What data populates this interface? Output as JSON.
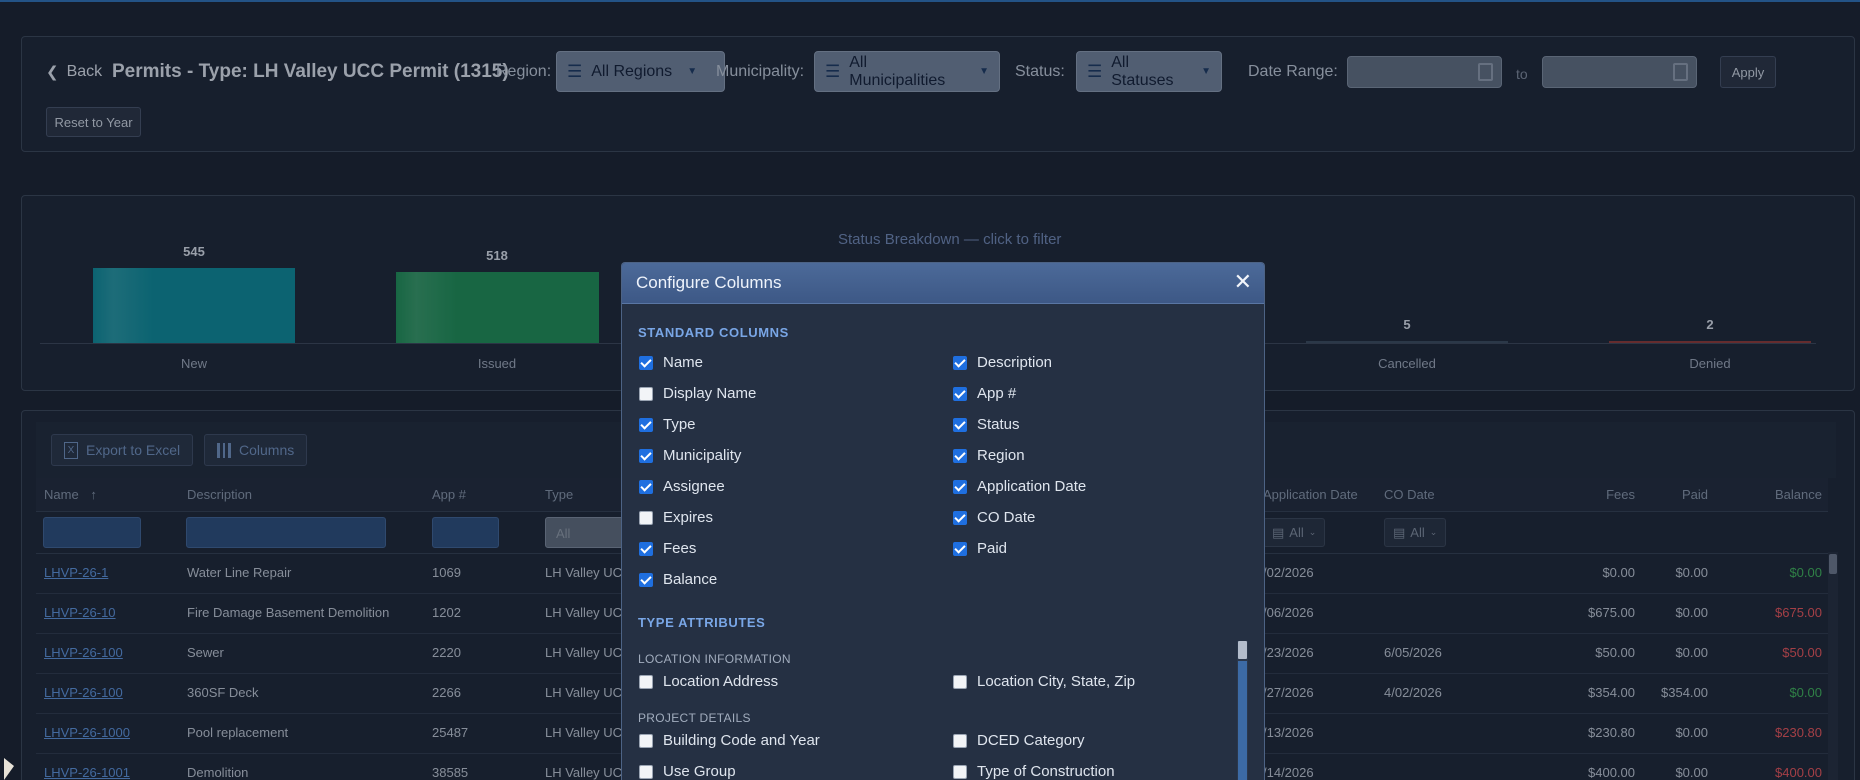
{
  "header": {
    "back_label": "Back",
    "title": "Permits - Type: LH Valley UCC Permit (1315)",
    "region_label": "Region:",
    "region_value": "All Regions",
    "municipality_label": "Municipality:",
    "municipality_value": "All Municipalities",
    "status_label": "Status:",
    "status_value": "All Statuses",
    "date_range_label": "Date Range:",
    "to_label": "to",
    "apply_label": "Apply",
    "reset_label": "Reset to Year"
  },
  "chart_data": {
    "type": "bar",
    "title": "Status Breakdown — click to filter",
    "categories": [
      "New",
      "Issued",
      "Cancelled",
      "Denied"
    ],
    "values": [
      545,
      518,
      5,
      2
    ],
    "colors": [
      "#0e8696",
      "#1f8a57",
      "#3a4a5e",
      "#8a3a3a"
    ]
  },
  "toolbar": {
    "export_label": "Export to Excel",
    "columns_label": "Columns"
  },
  "table": {
    "headers": [
      "Name",
      "Description",
      "App #",
      "Type",
      "Application Date",
      "CO Date",
      "Fees",
      "Paid",
      "Balance"
    ],
    "type_filter_placeholder": "All",
    "date_filter_all": "All",
    "rows": [
      {
        "name": "LHVP-26-1",
        "description": "Water Line Repair",
        "app": "1069",
        "type": "LH Valley UCC",
        "app_date": "/02/2026",
        "co_date": "",
        "fees": "$0.00",
        "paid": "$0.00",
        "balance": "$0.00",
        "bal_status": "zero"
      },
      {
        "name": "LHVP-26-10",
        "description": "Fire Damage Basement Demolition",
        "app": "1202",
        "type": "LH Valley UCC",
        "app_date": "/06/2026",
        "co_date": "",
        "fees": "$675.00",
        "paid": "$0.00",
        "balance": "$675.00",
        "bal_status": "due"
      },
      {
        "name": "LHVP-26-100",
        "description": "Sewer",
        "app": "2220",
        "type": "LH Valley UCC",
        "app_date": "/23/2026",
        "co_date": "6/05/2026",
        "fees": "$50.00",
        "paid": "$0.00",
        "balance": "$50.00",
        "bal_status": "due"
      },
      {
        "name": "LHVP-26-100",
        "description": "360SF Deck",
        "app": "2266",
        "type": "LH Valley UCC",
        "app_date": "/27/2026",
        "co_date": "4/02/2026",
        "fees": "$354.00",
        "paid": "$354.00",
        "balance": "$0.00",
        "bal_status": "zero"
      },
      {
        "name": "LHVP-26-1000",
        "description": "Pool replacement",
        "app": "25487",
        "type": "LH Valley UCC",
        "app_date": "/13/2026",
        "co_date": "",
        "fees": "$230.80",
        "paid": "$0.00",
        "balance": "$230.80",
        "bal_status": "due"
      },
      {
        "name": "LHVP-26-1001",
        "description": "Demolition",
        "app": "38585",
        "type": "LH Valley UCC",
        "app_date": "/14/2026",
        "co_date": "",
        "fees": "$400.00",
        "paid": "$0.00",
        "balance": "$400.00",
        "bal_status": "due"
      }
    ]
  },
  "modal": {
    "title": "Configure Columns",
    "close_glyph": "✕",
    "standard_heading": "STANDARD COLUMNS",
    "standard_columns": [
      {
        "label": "Name",
        "checked": true
      },
      {
        "label": "Description",
        "checked": true
      },
      {
        "label": "Display Name",
        "checked": false
      },
      {
        "label": "App #",
        "checked": true
      },
      {
        "label": "Type",
        "checked": true
      },
      {
        "label": "Status",
        "checked": true
      },
      {
        "label": "Municipality",
        "checked": true
      },
      {
        "label": "Region",
        "checked": true
      },
      {
        "label": "Assignee",
        "checked": true
      },
      {
        "label": "Application Date",
        "checked": true
      },
      {
        "label": "Expires",
        "checked": false
      },
      {
        "label": "CO Date",
        "checked": true
      },
      {
        "label": "Fees",
        "checked": true
      },
      {
        "label": "Paid",
        "checked": true
      },
      {
        "label": "Balance",
        "checked": true
      }
    ],
    "type_heading": "TYPE ATTRIBUTES",
    "groups": [
      {
        "heading": "LOCATION INFORMATION",
        "items": [
          {
            "label": "Location Address",
            "checked": false
          },
          {
            "label": "Location City, State, Zip",
            "checked": false
          }
        ]
      },
      {
        "heading": "PROJECT DETAILS",
        "items": [
          {
            "label": "Building Code and Year",
            "checked": false
          },
          {
            "label": "DCED Category",
            "checked": false
          },
          {
            "label": "Use Group",
            "checked": false
          },
          {
            "label": "Type of Construction",
            "checked": false
          }
        ]
      }
    ]
  }
}
